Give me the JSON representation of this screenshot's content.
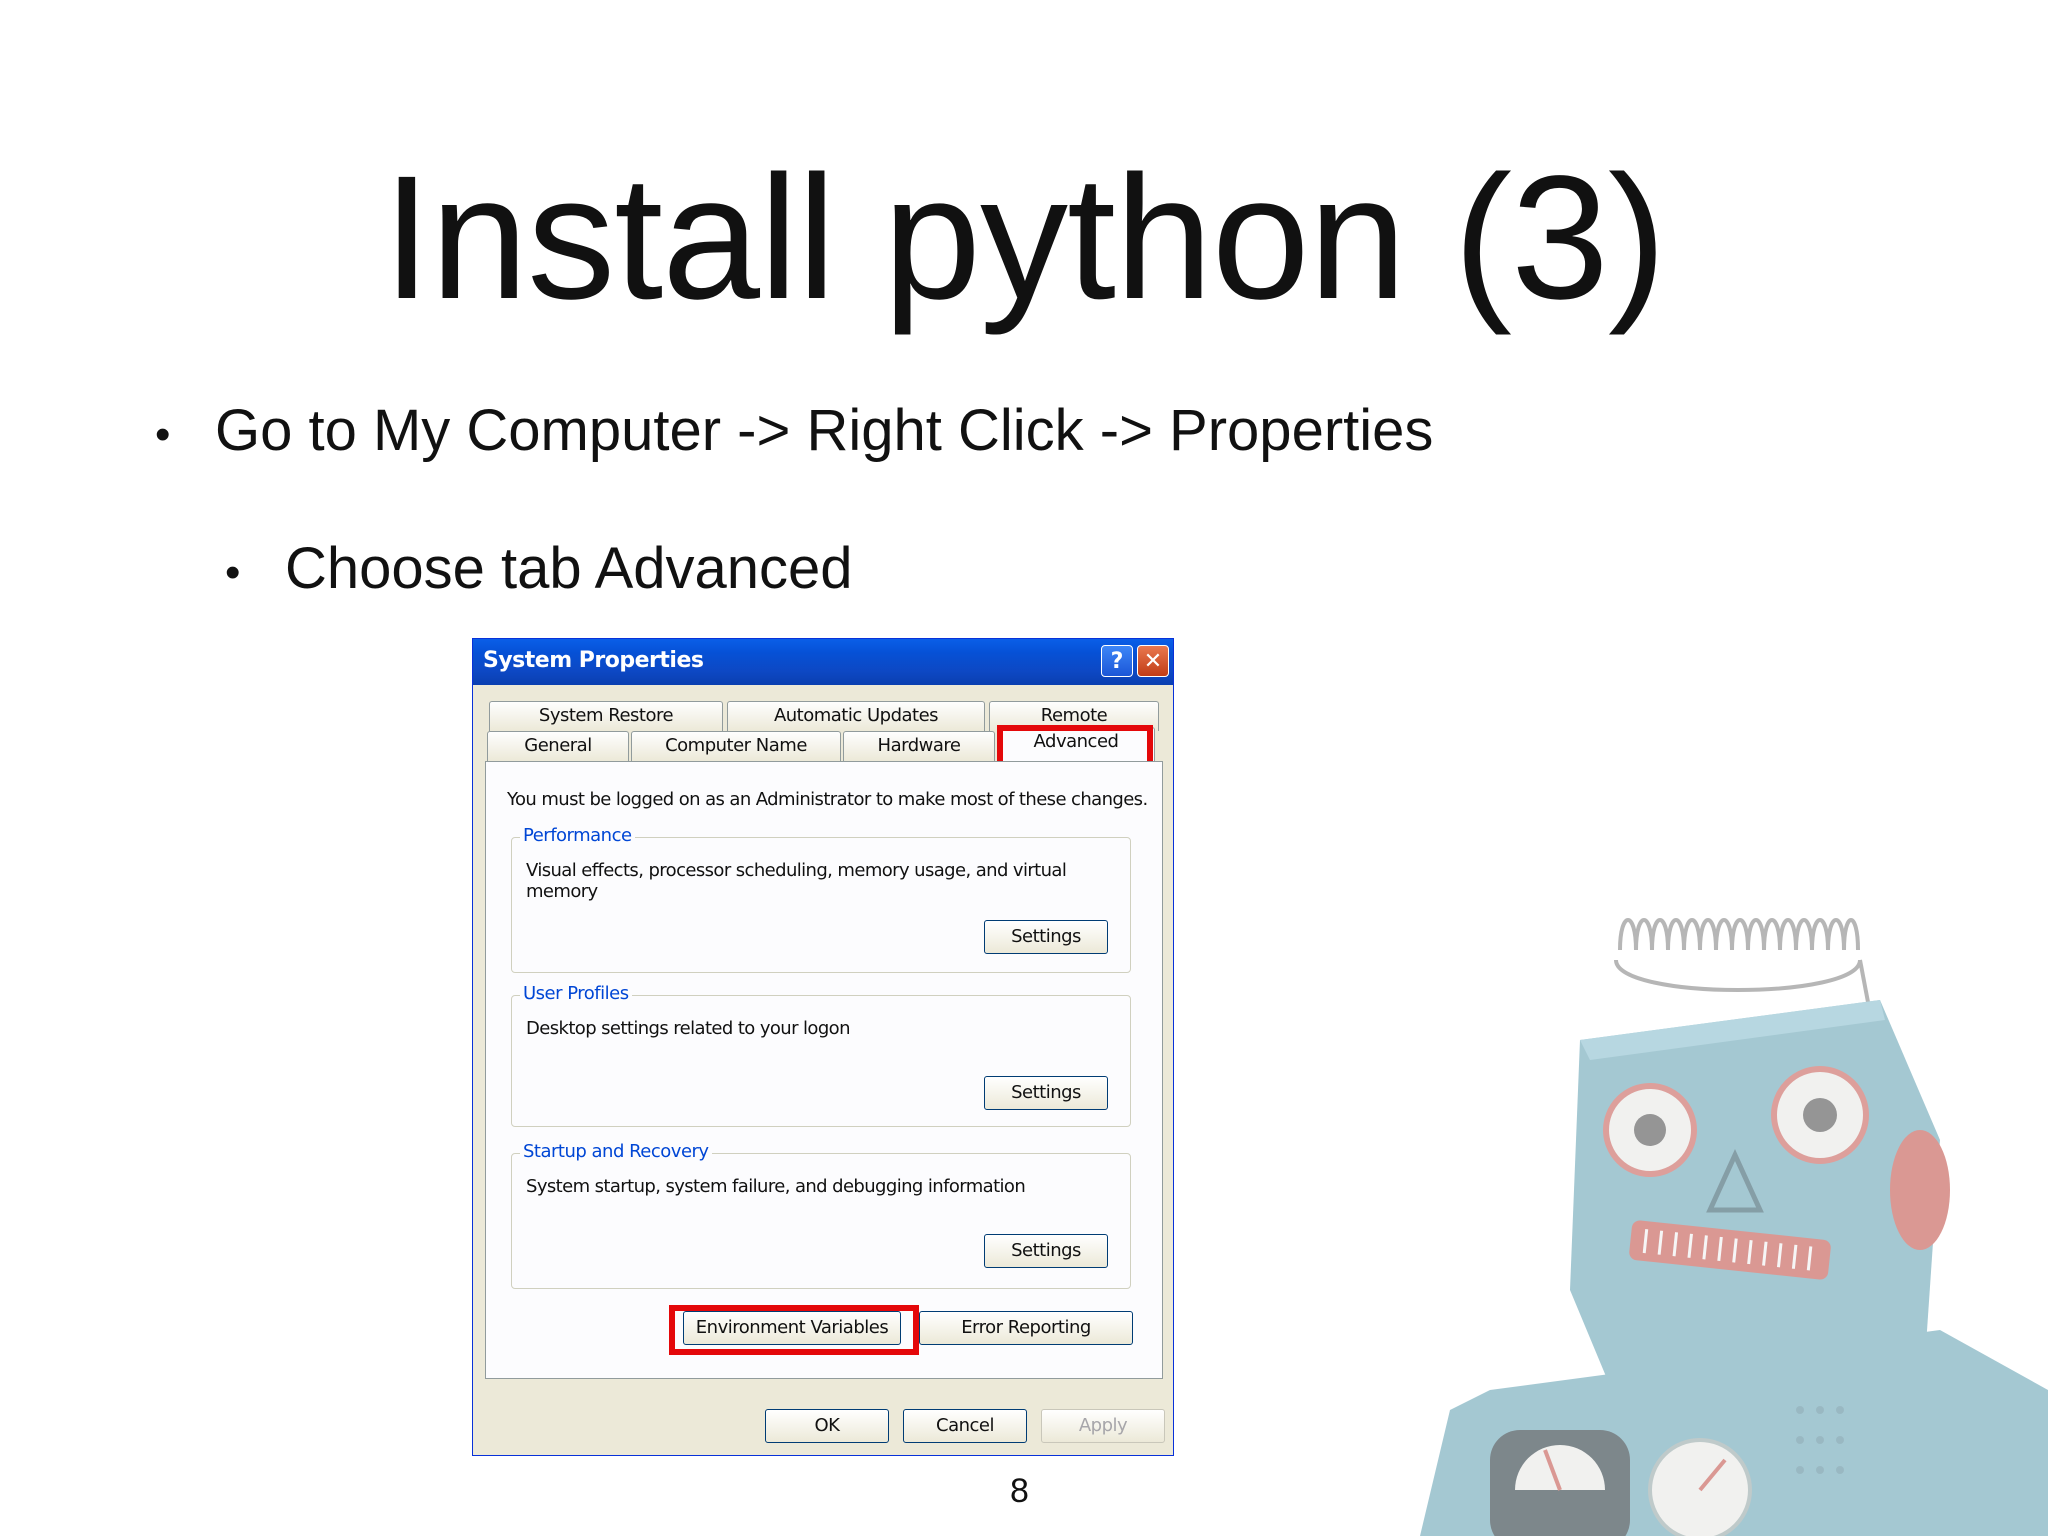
{
  "slide": {
    "title": "Install python (3)",
    "bullets": [
      "Go to My Computer ->  Right Click -> Properties",
      "Choose tab Advanced"
    ],
    "bullet_glyph": "•",
    "page_number": "8"
  },
  "dialog": {
    "title": "System Properties",
    "help_glyph": "?",
    "close_glyph": "✕",
    "tabs_row1": [
      "System Restore",
      "Automatic Updates",
      "Remote"
    ],
    "tabs_row2": [
      "General",
      "Computer Name",
      "Hardware",
      "Advanced"
    ],
    "active_tab": "Advanced",
    "admin_note": "You must be logged on as an Administrator to make most of these changes.",
    "groups": [
      {
        "title": "Performance",
        "description": "Visual effects, processor scheduling, memory usage, and virtual memory",
        "button": "Settings"
      },
      {
        "title": "User Profiles",
        "description": "Desktop settings related to your logon",
        "button": "Settings"
      },
      {
        "title": "Startup and Recovery",
        "description": "System startup, system failure, and debugging information",
        "button": "Settings"
      }
    ],
    "environment_variables_label": "Environment Variables",
    "error_reporting_label": "Error Reporting",
    "ok_label": "OK",
    "cancel_label": "Cancel",
    "apply_label": "Apply"
  },
  "colors": {
    "highlight_box": "#e4080a",
    "titlebar": "#0a5fe8",
    "group_title": "#0046d5",
    "robot_body": "#7fb3c4"
  },
  "icons": [
    "help-icon",
    "close-icon",
    "robot-illustration"
  ]
}
